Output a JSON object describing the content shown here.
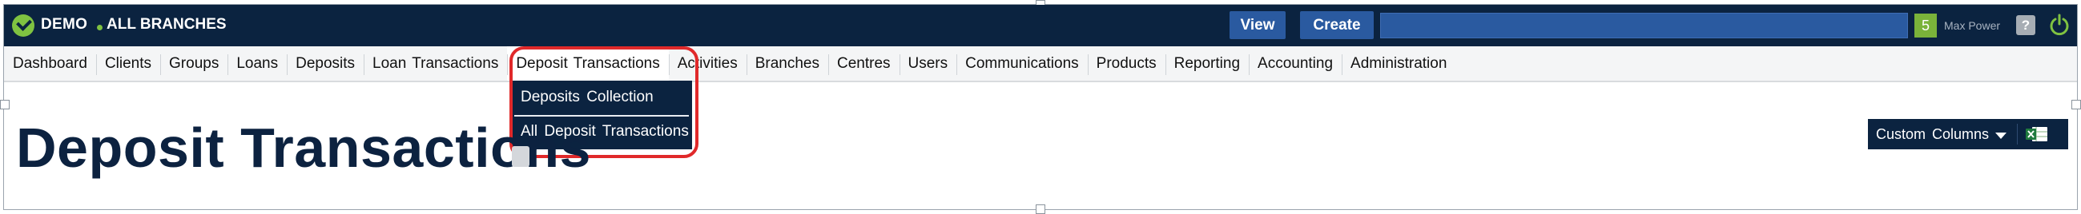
{
  "header": {
    "org": "DEMO",
    "branch": "ALL BRANCHES",
    "view_label": "View",
    "create_label": "Create",
    "search_value": "",
    "notification_count": "5",
    "user_name": "Max Power",
    "help_label": "?"
  },
  "menu": {
    "items": [
      {
        "label": "Dashboard"
      },
      {
        "label": "Clients"
      },
      {
        "label": "Groups"
      },
      {
        "label": "Loans"
      },
      {
        "label": "Deposits"
      },
      {
        "label": "Loan  Transactions"
      },
      {
        "label": "Deposit  Transactions"
      },
      {
        "label": "Activities"
      },
      {
        "label": "Branches"
      },
      {
        "label": "Centres"
      },
      {
        "label": "Users"
      },
      {
        "label": "Communications"
      },
      {
        "label": "Products"
      },
      {
        "label": "Reporting"
      },
      {
        "label": "Accounting"
      },
      {
        "label": "Administration"
      }
    ]
  },
  "dropdown": {
    "items": [
      {
        "label": "Deposits  Collection"
      },
      {
        "label": "All  Deposit  Transactions"
      }
    ]
  },
  "page": {
    "title": "Deposit Transactions",
    "custom_columns_label": "Custom  Columns"
  },
  "colors": {
    "navy": "#0b2340",
    "accent_blue": "#2a5aa0",
    "brand_green": "#7fc241",
    "highlight_red": "#e0292a"
  }
}
